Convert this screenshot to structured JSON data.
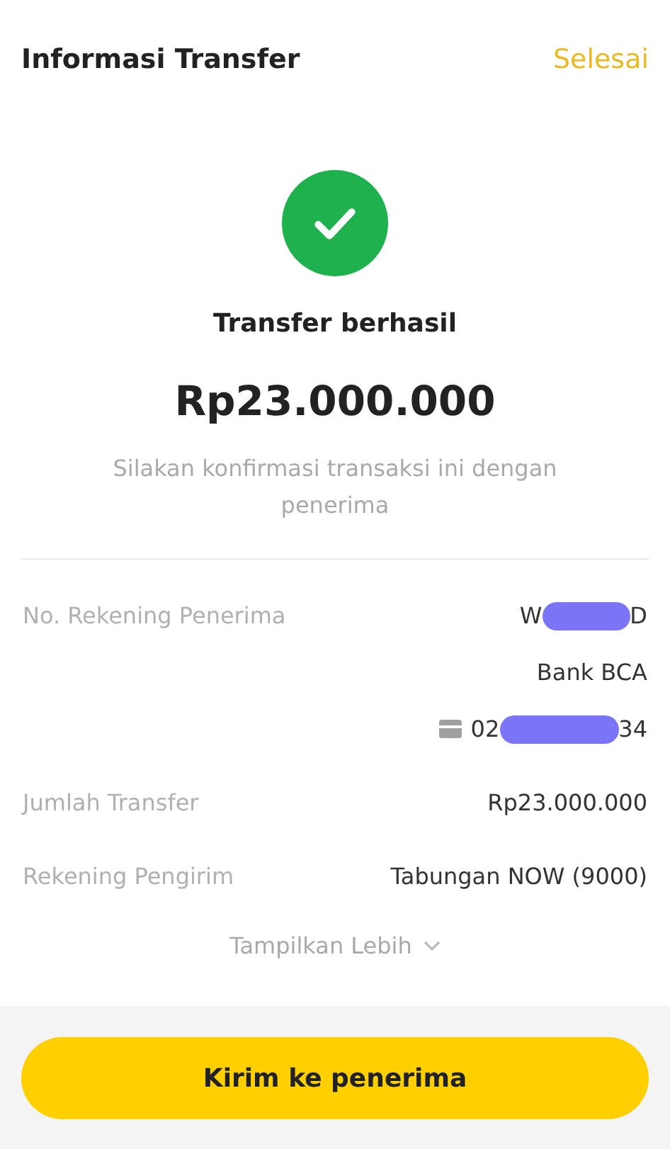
{
  "header": {
    "title": "Informasi Transfer",
    "action": "Selesai"
  },
  "status": {
    "title": "Transfer berhasil",
    "amount": "Rp23.000.000",
    "note": "Silakan konfirmasi transaksi ini dengan penerima"
  },
  "recipient": {
    "label": "No. Rekening Penerima",
    "name_start": "W",
    "name_end": "D",
    "bank": "Bank BCA",
    "account_start": "02",
    "account_end": "34"
  },
  "details": [
    {
      "label": "Jumlah Transfer",
      "value": "Rp23.000.000"
    },
    {
      "label": "Rekening Pengirim",
      "value": "Tabungan NOW (9000)"
    }
  ],
  "more": {
    "label": "Tampilkan Lebih",
    "expanded": false
  },
  "button": {
    "label": "Kirim ke penerima"
  }
}
